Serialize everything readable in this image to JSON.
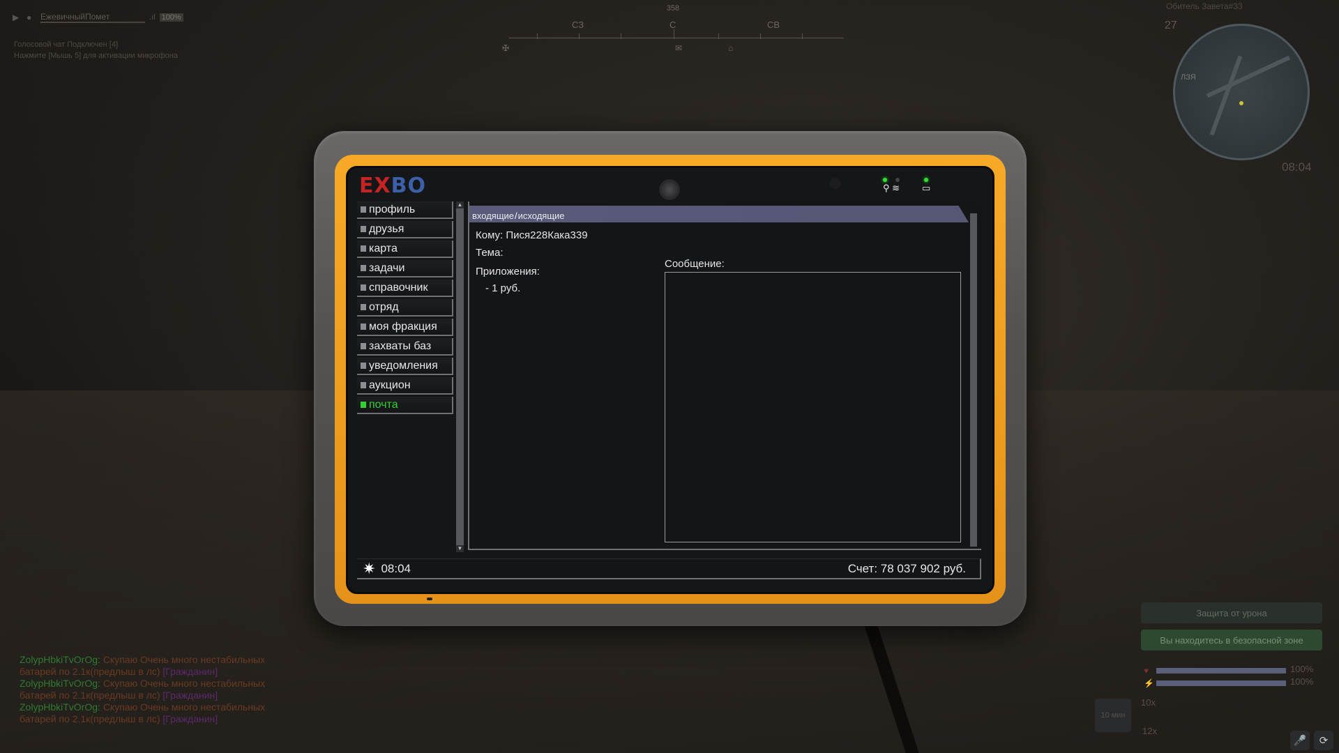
{
  "hud": {
    "voice": {
      "player_name": "ЕжевичныйПомет",
      "volume": "100%",
      "status_line": "Голосовой чат Подключен [4]",
      "hint_line": "Нажмите [Мышь 5] для активации микрофона"
    },
    "compass": {
      "bearing": "358",
      "dir_nw": "СЗ",
      "dir_n": "С",
      "dir_ne": "СВ"
    },
    "minimap": {
      "location": "Обитель Завета#33",
      "number": "27",
      "time": "08:04",
      "label": "ЛЗЯ"
    },
    "protect_label": "Защита от урона",
    "safe_zone_label": "Вы находитесь в безопасной зоне",
    "health": "100%",
    "energy": "100%",
    "slot_time": "10 мин",
    "item_count_top": "10х",
    "item_count_bottom": "12х"
  },
  "tablet": {
    "logo_ex": "EX",
    "logo_bo": "BO",
    "nav": [
      {
        "label": "профиль"
      },
      {
        "label": "друзья"
      },
      {
        "label": "карта"
      },
      {
        "label": "задачи"
      },
      {
        "label": "справочник"
      },
      {
        "label": "отряд"
      },
      {
        "label": "моя фракция"
      },
      {
        "label": "захваты баз"
      },
      {
        "label": "уведомления"
      },
      {
        "label": "аукцион"
      },
      {
        "label": "почта"
      }
    ],
    "mail": {
      "tab_incoming": "входящие",
      "tab_sep": "/",
      "tab_outgoing": "исходящие",
      "to_label": "Кому: Пися228Кака339",
      "subject_label": "Тема:",
      "attachments_label": "Приложения:",
      "attachment_item": "- 1 руб.",
      "message_label": "Сообщение:",
      "message_body": ""
    },
    "status": {
      "time": "08:04",
      "balance": "Счет: 78 037 902 руб."
    },
    "colors": {
      "bezel": "#f6a927",
      "active_nav": "#32d232",
      "tab_bar": "#5a5a7a"
    }
  },
  "chat": [
    {
      "nick": "ZolypHbkiTvOrOg:",
      "text": "Скупаю Очень много нестабильных",
      "tag": ""
    },
    {
      "nick": "",
      "text": "батарей по 2.1к(предлыш в лс)",
      "tag": "[Гражданин]"
    },
    {
      "nick": "ZolypHbkiTvOrOg:",
      "text": "Скупаю Очень много нестабильных",
      "tag": ""
    },
    {
      "nick": "",
      "text": "батарей по 2.1к(предлыш в лс)",
      "tag": "[Гражданин]"
    },
    {
      "nick": "ZolypHbkiTvOrOg:",
      "text": "Скупаю Очень много нестабильных",
      "tag": ""
    },
    {
      "nick": "",
      "text": "батарей по 2.1к(предлыш в лс)",
      "tag": "[Гражданин]"
    }
  ]
}
